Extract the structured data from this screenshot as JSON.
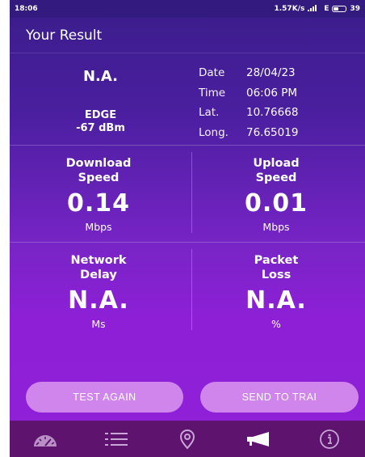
{
  "status_bar": {
    "time": "18:06",
    "speed": "1.57K/s",
    "network": "E",
    "battery": "39"
  },
  "header": {
    "title": "Your Result"
  },
  "summary": {
    "signal_value": "N.A.",
    "network_type": "EDGE",
    "signal_strength": "-67 dBm",
    "details": [
      {
        "label": "Date",
        "value": "28/04/23"
      },
      {
        "label": "Time",
        "value": "06:06 PM"
      },
      {
        "label": "Lat.",
        "value": "10.76668"
      },
      {
        "label": "Long.",
        "value": "76.65019"
      }
    ]
  },
  "metrics": {
    "download": {
      "title_line1": "Download",
      "title_line2": "Speed",
      "value": "0.14",
      "unit": "Mbps"
    },
    "upload": {
      "title_line1": "Upload",
      "title_line2": "Speed",
      "value": "0.01",
      "unit": "Mbps"
    },
    "delay": {
      "title_line1": "Network",
      "title_line2": "Delay",
      "value": "N.A.",
      "unit": "Ms"
    },
    "loss": {
      "title_line1": "Packet",
      "title_line2": "Loss",
      "value": "N.A.",
      "unit": "%"
    }
  },
  "buttons": {
    "test_again": "TEST AGAIN",
    "send_to_trai": "SEND TO TRAI"
  },
  "nav": {
    "items": [
      {
        "icon": "speedometer-icon"
      },
      {
        "icon": "list-icon"
      },
      {
        "icon": "location-pin-icon"
      },
      {
        "icon": "megaphone-icon"
      },
      {
        "icon": "info-icon"
      }
    ]
  },
  "colors": {
    "header_bg": "#3a1d8a",
    "gradient_bottom": "#8f20d8",
    "button_bg": "#db98ef",
    "navbar_bg": "#5e136f"
  }
}
